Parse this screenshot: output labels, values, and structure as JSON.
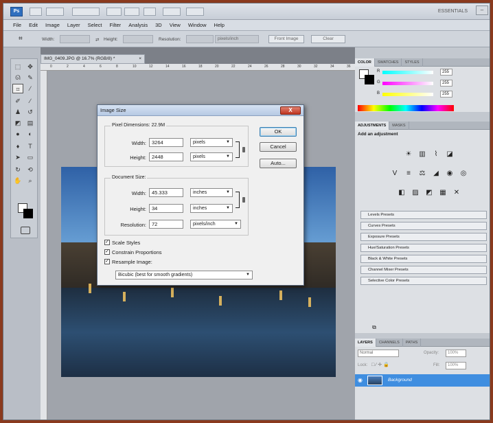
{
  "app": {
    "logo": "Ps",
    "workspace": "ESSENTIALS"
  },
  "menu": [
    "File",
    "Edit",
    "Image",
    "Layer",
    "Select",
    "Filter",
    "Analysis",
    "3D",
    "View",
    "Window",
    "Help"
  ],
  "options_bar": {
    "width_label": "Width:",
    "height_label": "Height:",
    "resolution_label": "Resolution:",
    "units_value": "pixels/inch",
    "front_image_label": "Front Image",
    "clear_label": "Clear"
  },
  "document": {
    "tab_title": "IMG_0409.JPG @ 16.7% (RGB/8) *",
    "ruler_numbers": [
      "0",
      "2",
      "4",
      "6",
      "8",
      "10",
      "12",
      "14",
      "16",
      "18",
      "20",
      "22",
      "24",
      "26",
      "28",
      "30",
      "32",
      "34",
      "36"
    ]
  },
  "panels": {
    "color_tabs": [
      "COLOR",
      "SWATCHES",
      "STYLES"
    ],
    "color_values": {
      "r": "255",
      "g": "255",
      "b": "255"
    },
    "adjustments_tabs": [
      "ADJUSTMENTS",
      "MASKS"
    ],
    "add_adjustment": "Add an adjustment",
    "presets": [
      "Levels Presets",
      "Curves Presets",
      "Exposure Presets",
      "Hue/Saturation Presets",
      "Black & White Presets",
      "Channel Mixer Presets",
      "Selective Color Presets"
    ],
    "layers_tabs": [
      "LAYERS",
      "CHANNELS",
      "PATHS"
    ],
    "blend_mode": "Normal",
    "opacity_label": "Opacity:",
    "opacity_value": "100%",
    "lock_label": "Lock:",
    "fill_label": "Fill:",
    "fill_value": "100%",
    "layer_name": "Background"
  },
  "dialog": {
    "title": "Image Size",
    "pixel_dimensions_label": "Pixel Dimensions:",
    "pixel_dimensions_value": "22.9M",
    "px_width_label": "Width:",
    "px_width_value": "3264",
    "px_width_unit": "pixels",
    "px_height_label": "Height:",
    "px_height_value": "2448",
    "px_height_unit": "pixels",
    "document_size_label": "Document Size:",
    "doc_width_label": "Width:",
    "doc_width_value": "45.333",
    "doc_width_unit": "inches",
    "doc_height_label": "Height:",
    "doc_height_value": "34",
    "doc_height_unit": "inches",
    "resolution_label": "Resolution:",
    "resolution_value": "72",
    "resolution_unit": "pixels/inch",
    "scale_styles": "Scale Styles",
    "constrain_proportions": "Constrain Proportions",
    "resample_image": "Resample Image:",
    "resample_method": "Bicubic (best for smooth gradients)",
    "ok_label": "OK",
    "cancel_label": "Cancel",
    "auto_label": "Auto...",
    "close_label": "X"
  },
  "colors": {
    "accent": "#3f8ee0",
    "frame": "#8a3a1e"
  }
}
